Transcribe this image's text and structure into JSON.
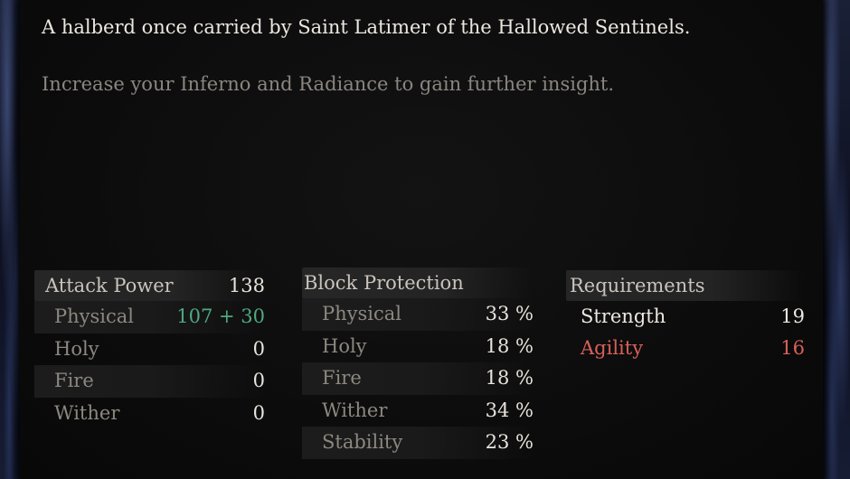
{
  "item": {
    "description": "A halberd once carried by Saint Latimer of the Hallowed Sentinels.",
    "hint": "Increase your Inferno and Radiance to gain further insight."
  },
  "attack_power": {
    "label": "Attack Power",
    "total": "138",
    "rows": [
      {
        "label": "Physical",
        "value": "107 + 30"
      },
      {
        "label": "Holy",
        "value": "0"
      },
      {
        "label": "Fire",
        "value": "0"
      },
      {
        "label": "Wither",
        "value": "0"
      }
    ]
  },
  "block_protection": {
    "label": "Block Protection",
    "rows": [
      {
        "label": "Physical",
        "value": "33 %"
      },
      {
        "label": "Holy",
        "value": "18 %"
      },
      {
        "label": "Fire",
        "value": "18 %"
      },
      {
        "label": "Wither",
        "value": "34 %"
      },
      {
        "label": "Stability",
        "value": "23 %"
      }
    ]
  },
  "requirements": {
    "label": "Requirements",
    "rows": [
      {
        "label": "Strength",
        "value": "19"
      },
      {
        "label": "Agility",
        "value": "16"
      }
    ]
  },
  "colors": {
    "boost_value": "#4fa882",
    "unmet_requirement": "#d9605a"
  }
}
